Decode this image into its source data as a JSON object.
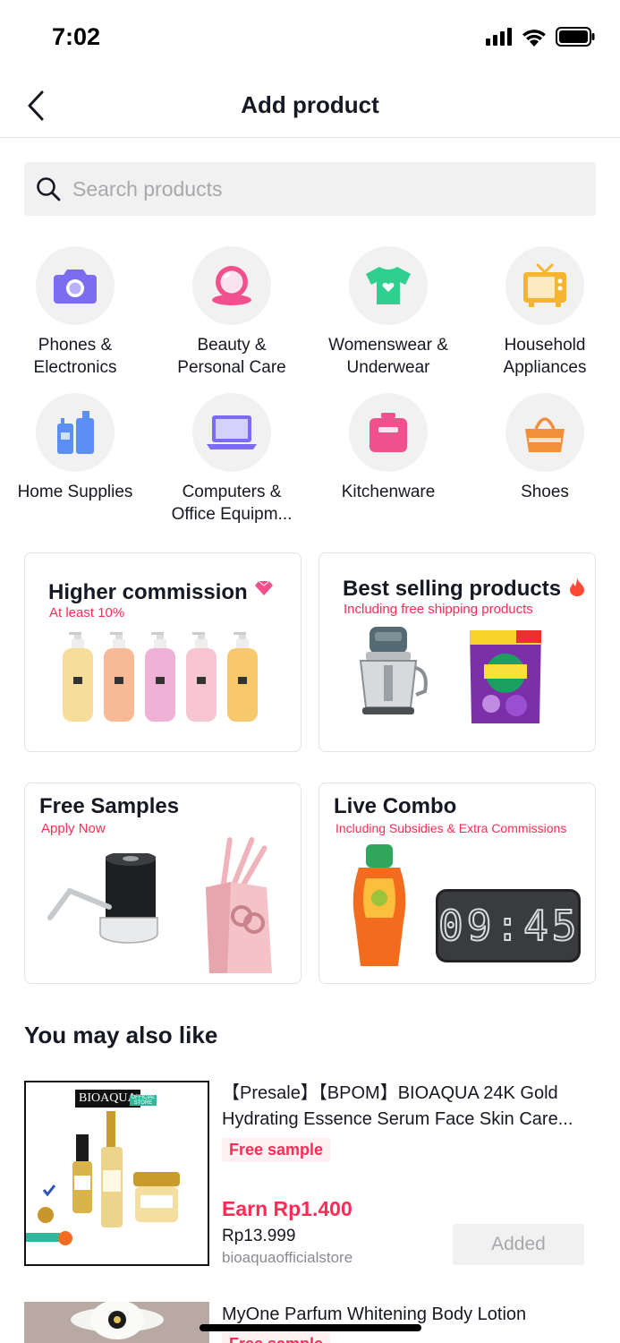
{
  "status_bar": {
    "time": "7:02"
  },
  "header": {
    "title": "Add product"
  },
  "search": {
    "placeholder": "Search products"
  },
  "categories": [
    {
      "label": "Phones &\nElectronics",
      "icon": "camera-icon",
      "color": "#7b6cf0"
    },
    {
      "label": "Beauty &\nPersonal Care",
      "icon": "compact-mirror-icon",
      "color": "#f0508c"
    },
    {
      "label": "Womenswear &\nUnderwear",
      "icon": "tshirt-icon",
      "color": "#2fcf8f"
    },
    {
      "label": "Household\nAppliances",
      "icon": "tv-icon",
      "color": "#f5b531"
    },
    {
      "label": "Home Supplies",
      "icon": "bottles-icon",
      "color": "#5b8ff5"
    },
    {
      "label": "Computers &\nOffice Equipm...",
      "icon": "laptop-icon",
      "color": "#7b6cf0"
    },
    {
      "label": "Kitchenware",
      "icon": "pot-icon",
      "color": "#f0508c"
    },
    {
      "label": "Shoes",
      "icon": "bag-icon",
      "color": "#f2903a"
    }
  ],
  "promos": [
    {
      "title": "Higher commission",
      "subtitle": "At least 10%",
      "icon": "diamond-icon"
    },
    {
      "title": "Best selling products",
      "subtitle": "Including free shipping products",
      "icon": "fire-icon"
    },
    {
      "title": "Free Samples",
      "subtitle": "Apply Now"
    },
    {
      "title": "Live Combo",
      "subtitle": "Including Subsidies & Extra Commissions",
      "clock_display": "09:45"
    }
  ],
  "section": {
    "title": "You may also like"
  },
  "products": [
    {
      "title": "【Presale】【BPOM】BIOAQUA 24K Gold Hydrating Essence Serum Face Skin Care...",
      "tag": "Free sample",
      "earn": "Earn Rp1.400",
      "price": "Rp13.999",
      "store": "bioaquaofficialstore",
      "action": "Added",
      "brand": "BIOAQUA",
      "brand_badge": "OFFICIAL STORE"
    },
    {
      "title": "MyOne Parfum Whitening Body Lotion",
      "tag": "Free sample"
    }
  ]
}
